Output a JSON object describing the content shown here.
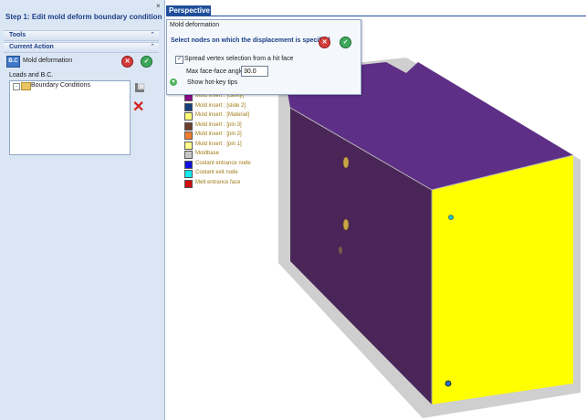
{
  "left_panel": {
    "step_title": "Step 1: Edit mold deform boundary condition",
    "tools_header": "Tools",
    "current_action_header": "Current Action",
    "action_icon_text": "B.C",
    "action_label": "Mold deformation",
    "loads_label": "Loads and B.C.",
    "tree_item": "Boundary Conditions",
    "tree_expand": "-"
  },
  "top_strip": {
    "close_glyph": "×",
    "perspective_tab": "Perspective"
  },
  "dialog": {
    "title": "Mold deformation",
    "prompt": "Select nodes on which the displacement is specified",
    "spread_checked": true,
    "spread_label": "Spread vertex selection from a hit face",
    "angle_label": "Max face-face angle",
    "angle_value": "30.0",
    "hotkey_label": "Show hot-key tips"
  },
  "legend": [
    {
      "label": "Mold insert : [cavity]",
      "color": "#8a0a8a"
    },
    {
      "label": "Mold insert : [slide 2]",
      "color": "#173f7a"
    },
    {
      "label": "Mold insert : [Material]",
      "color": "#ffff7a"
    },
    {
      "label": "Mold insert : [pin 3]",
      "color": "#6b3e2e"
    },
    {
      "label": "Mold insert : [pin 2]",
      "color": "#f07c2c"
    },
    {
      "label": "Mold insert : [pin 1]",
      "color": "#ffff8c"
    },
    {
      "label": "Moldbase",
      "color": "#c6c6c6"
    },
    {
      "label": "Coolant entrance node",
      "color": "#1010e0"
    },
    {
      "label": "Coolant exit node",
      "color": "#14e8ec"
    },
    {
      "label": "Melt entrance face",
      "color": "#d01010"
    }
  ],
  "colors": {
    "accent": "#1f4f99",
    "panel_bg": "#dbe6f4",
    "mold_top": "#5e2f86",
    "mold_front": "#4a2557",
    "mold_side": "#ffff00",
    "moldbase": "#c8c8c8"
  },
  "icons": {
    "cancel": "cancel-icon",
    "confirm": "confirm-icon",
    "add_bc": "add-bc-icon",
    "delete_bc": "delete-icon",
    "hotkey": "expand-icon"
  }
}
